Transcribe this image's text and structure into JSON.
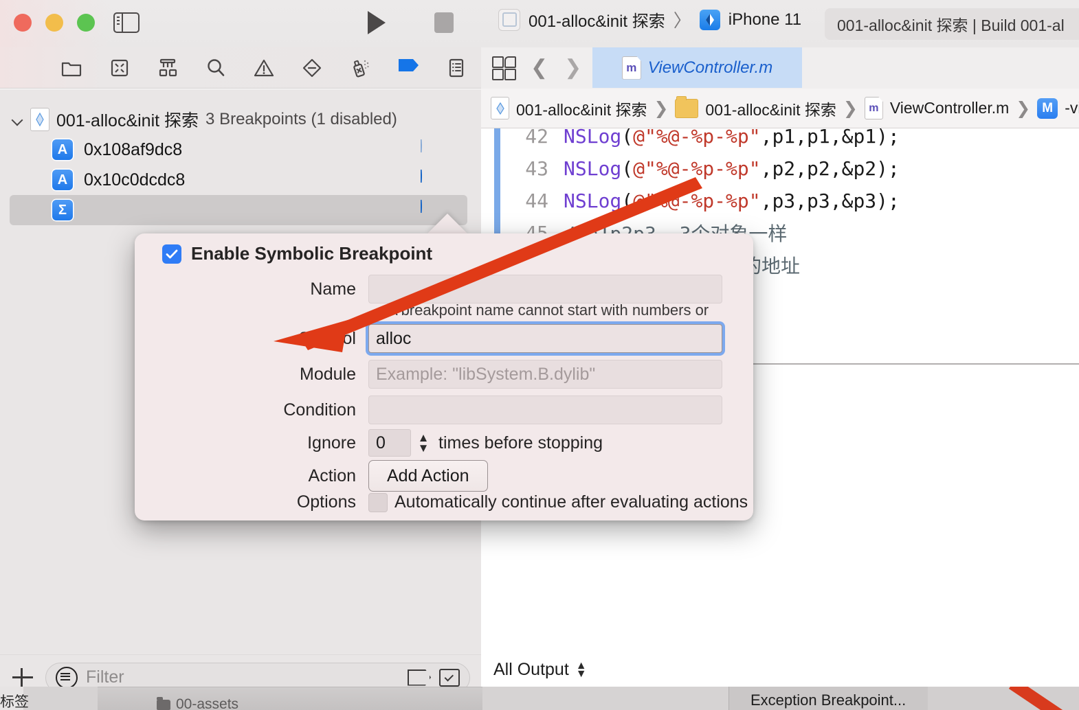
{
  "window": {
    "traffic_lights": [
      "close",
      "minimize",
      "zoom"
    ],
    "sidebar_toggle_name": "sidebar-toggle",
    "run_label": "Run",
    "stop_label": "Stop"
  },
  "scheme": {
    "project_name": "001-alloc&init 探索",
    "separator": "〉",
    "destination": "iPhone 11"
  },
  "status": {
    "text": "001-alloc&init 探索 | Build 001-al"
  },
  "navigator_tabs": [
    {
      "name": "project-navigator",
      "icon": "folder-icon"
    },
    {
      "name": "source-control-navigator",
      "icon": "source-control-icon"
    },
    {
      "name": "symbol-navigator",
      "icon": "hierarchy-icon"
    },
    {
      "name": "find-navigator",
      "icon": "search-icon"
    },
    {
      "name": "issue-navigator",
      "icon": "warning-icon"
    },
    {
      "name": "test-navigator",
      "icon": "test-diamond-icon"
    },
    {
      "name": "debug-navigator",
      "icon": "debug-spray-icon"
    },
    {
      "name": "breakpoint-navigator",
      "icon": "breakpoint-icon"
    },
    {
      "name": "report-navigator",
      "icon": "report-icon"
    }
  ],
  "breakpoints": {
    "group_title": "001-alloc&init 探索",
    "group_subtitle": "3 Breakpoints (1 disabled)",
    "rows": [
      {
        "symbol": "A",
        "label": "0x108af9dc8",
        "enabled": false,
        "selected": false
      },
      {
        "symbol": "A",
        "label": "0x10c0dcdc8",
        "enabled": true,
        "selected": false
      },
      {
        "symbol": "Σ",
        "label": "",
        "enabled": true,
        "selected": true
      }
    ]
  },
  "filter_bar": {
    "add_label": "+",
    "placeholder": "Filter",
    "filter_icon": "filter-lines-icon",
    "right_icons": [
      "breakpoint-filter-icon",
      "enabled-filter-icon"
    ]
  },
  "editor": {
    "tab": {
      "filename": "ViewController.m",
      "icon": "m-file-icon"
    },
    "breadcrumb": [
      {
        "icon": "project-icon",
        "label": "001-alloc&init 探索"
      },
      {
        "icon": "folder-icon",
        "label": "001-alloc&init 探索"
      },
      {
        "icon": "m-file-icon",
        "label": "ViewController.m"
      },
      {
        "icon": "method-icon",
        "label": "-view"
      }
    ],
    "code_lines": [
      {
        "number": "42",
        "tokens": [
          {
            "t": "NSLog",
            "c": "fn"
          },
          {
            "t": "(",
            "c": "plain"
          },
          {
            "t": "@\"%@-%p-%p\"",
            "c": "str"
          },
          {
            "t": ",p1,p1,&p1);",
            "c": "plain"
          }
        ]
      },
      {
        "number": "43",
        "tokens": [
          {
            "t": "NSLog",
            "c": "fn"
          },
          {
            "t": "(",
            "c": "plain"
          },
          {
            "t": "@\"%@-%p-%p\"",
            "c": "str"
          },
          {
            "t": ",p2,p2,&p2);",
            "c": "plain"
          }
        ]
      },
      {
        "number": "44",
        "tokens": [
          {
            "t": "NSLog",
            "c": "fn"
          },
          {
            "t": "(",
            "c": "plain"
          },
          {
            "t": "@\"%@-%p-%p\"",
            "c": "str"
          },
          {
            "t": ",p3,p3,&p3);",
            "c": "plain"
          }
        ]
      },
      {
        "number": "45",
        "tokens": [
          {
            "t": "//p1p2p3  3个对象一样",
            "c": "cmt"
          }
        ]
      },
      {
        "number": "",
        "tokens": [
          {
            "t": "的地址",
            "c": "cmt"
          }
        ]
      }
    ]
  },
  "console": {
    "scope_label": "All Output",
    "stepper_icon": "up-down-chevrons-icon"
  },
  "popover": {
    "title": "Enable Symbolic Breakpoint",
    "enabled": true,
    "fields": {
      "name_label": "Name",
      "name_value": "",
      "name_hint": "A breakpoint name cannot start with numbers or contain any white space.",
      "symbol_label": "Symbol",
      "symbol_value": "alloc",
      "module_label": "Module",
      "module_placeholder": "Example: \"libSystem.B.dylib\"",
      "condition_label": "Condition",
      "condition_value": "",
      "ignore_label": "Ignore",
      "ignore_value": "0",
      "ignore_suffix": "times before stopping",
      "action_label": "Action",
      "action_button": "Add Action",
      "options_label": "Options",
      "options_checkbox_label": "Automatically continue after evaluating actions",
      "options_checked": false
    }
  },
  "annotation": {
    "arrow_color": "#e03a17",
    "from": "code line 44",
    "to": "Symbol field"
  },
  "background_window": {
    "left_tab_label": "标签",
    "asset_label": "00-assets",
    "menu_item": "Exception Breakpoint..."
  },
  "colors": {
    "accent_blue": "#1575e8",
    "breakpoint_disabled": "#a9c7ec",
    "popover_bg": "#f3e9ea",
    "selection_bg": "#cdcaca",
    "tab_active_bg": "#c7dcf6",
    "annotation_red": "#e03a17"
  }
}
